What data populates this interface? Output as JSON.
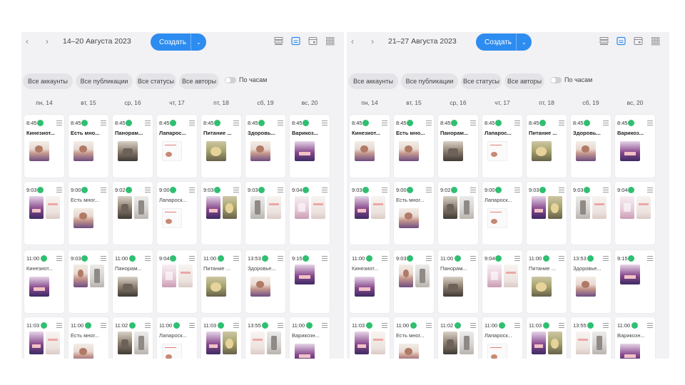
{
  "panels": [
    {
      "week_label": "14–20 Августа 2023",
      "create_label": "Создать",
      "filters": [
        "Все аккаунты",
        "Все публикации",
        "Все статусы",
        "Все авторы"
      ],
      "hourly_label": "По часам",
      "days": [
        "пн, 14",
        "вт, 15",
        "ср, 16",
        "чт, 17",
        "пт, 18",
        "сб, 19",
        "вс, 20"
      ],
      "rows": [
        [
          {
            "time": "8:45",
            "title": "Кинезиот...",
            "bold": true,
            "thumbs": [
              "portrait"
            ]
          },
          {
            "time": "8:45",
            "title": "Есть мно...",
            "bold": true,
            "thumbs": [
              "portrait"
            ]
          },
          {
            "time": "8:45",
            "title": "Панорам...",
            "bold": true,
            "thumbs": [
              "kitchen"
            ]
          },
          {
            "time": "8:45",
            "title": "Лапарос...",
            "bold": true,
            "thumbs": [
              "white"
            ]
          },
          {
            "time": "8:45",
            "title": "Питание ...",
            "bold": true,
            "thumbs": [
              "food"
            ]
          },
          {
            "time": "8:45",
            "title": "Здоровь...",
            "bold": true,
            "thumbs": [
              "portrait"
            ]
          },
          {
            "time": "8:45",
            "title": "Варикоз...",
            "bold": true,
            "thumbs": [
              "purple"
            ]
          }
        ],
        [
          {
            "time": "9:03",
            "title": "",
            "bold": false,
            "thumbs": [
              "purple",
              "light"
            ]
          },
          {
            "time": "9:00",
            "title": "Есть мног...",
            "bold": false,
            "thumbs": [
              "portrait"
            ]
          },
          {
            "time": "9:02",
            "title": "",
            "bold": false,
            "thumbs": [
              "kitchen",
              "gray"
            ]
          },
          {
            "time": "9:00",
            "title": "Лапароск...",
            "bold": false,
            "thumbs": [
              "white"
            ]
          },
          {
            "time": "9:03",
            "title": "",
            "bold": false,
            "thumbs": [
              "purple",
              "food"
            ]
          },
          {
            "time": "9:03",
            "title": "",
            "bold": false,
            "thumbs": [
              "gray",
              "light"
            ]
          },
          {
            "time": "9:04",
            "title": "",
            "bold": false,
            "thumbs": [
              "pink",
              "light"
            ]
          }
        ],
        [
          {
            "time": "11:00",
            "title": "Кинезиот...",
            "bold": false,
            "thumbs": [
              "purple"
            ]
          },
          {
            "time": "9:03",
            "title": "",
            "bold": false,
            "thumbs": [
              "portrait",
              "gray"
            ]
          },
          {
            "time": "11:00",
            "title": "Панорам...",
            "bold": false,
            "thumbs": [
              "kitchen"
            ]
          },
          {
            "time": "9:04",
            "title": "",
            "bold": false,
            "thumbs": [
              "pink",
              "light"
            ]
          },
          {
            "time": "11:00",
            "title": "Питание ...",
            "bold": false,
            "thumbs": [
              "food"
            ]
          },
          {
            "time": "13:53",
            "title": "Здоровье...",
            "bold": false,
            "thumbs": [
              "portrait"
            ]
          },
          {
            "time": "9:15",
            "title": "",
            "bold": false,
            "thumbs": [
              "purple"
            ]
          }
        ],
        [
          {
            "time": "11:03",
            "title": "",
            "bold": false,
            "thumbs": [
              "purple",
              "light"
            ]
          },
          {
            "time": "11:00",
            "title": "Есть мног...",
            "bold": false,
            "thumbs": [
              "portrait"
            ]
          },
          {
            "time": "11:02",
            "title": "",
            "bold": false,
            "thumbs": [
              "kitchen",
              "gray"
            ]
          },
          {
            "time": "11:00",
            "title": "Лапароск...",
            "bold": false,
            "thumbs": [
              "white"
            ]
          },
          {
            "time": "11:03",
            "title": "",
            "bold": false,
            "thumbs": [
              "purple",
              "food"
            ]
          },
          {
            "time": "13:55",
            "title": "",
            "bold": false,
            "thumbs": [
              "light",
              "gray"
            ]
          },
          {
            "time": "11:00",
            "title": "Варикозн...",
            "bold": false,
            "thumbs": [
              "purple"
            ]
          }
        ]
      ]
    },
    {
      "week_label": "21–27 Августа 2023",
      "create_label": "Создать",
      "filters": [
        "Все аккаунты",
        "Все публикации",
        "Все статусы",
        "Все авторы"
      ],
      "hourly_label": "По часам",
      "days": [
        "пн, 14",
        "вт, 15",
        "ср, 16",
        "чт, 17",
        "пт, 18",
        "сб, 19",
        "вс, 20"
      ],
      "rows": [
        [
          {
            "time": "8:45",
            "title": "Кинезиот...",
            "bold": true,
            "thumbs": [
              "portrait"
            ]
          },
          {
            "time": "8:45",
            "title": "Есть мно...",
            "bold": true,
            "thumbs": [
              "portrait"
            ]
          },
          {
            "time": "8:45",
            "title": "Панорам...",
            "bold": true,
            "thumbs": [
              "kitchen"
            ]
          },
          {
            "time": "8:45",
            "title": "Лапарос...",
            "bold": true,
            "thumbs": [
              "white"
            ]
          },
          {
            "time": "8:45",
            "title": "Питание ...",
            "bold": true,
            "thumbs": [
              "food"
            ]
          },
          {
            "time": "8:45",
            "title": "Здоровь...",
            "bold": true,
            "thumbs": [
              "portrait"
            ]
          },
          {
            "time": "8:45",
            "title": "Варикоз...",
            "bold": true,
            "thumbs": [
              "purple"
            ]
          }
        ],
        [
          {
            "time": "9:03",
            "title": "",
            "bold": false,
            "thumbs": [
              "purple",
              "light"
            ]
          },
          {
            "time": "9:00",
            "title": "Есть мног...",
            "bold": false,
            "thumbs": [
              "portrait"
            ]
          },
          {
            "time": "9:02",
            "title": "",
            "bold": false,
            "thumbs": [
              "kitchen",
              "gray"
            ]
          },
          {
            "time": "9:00",
            "title": "Лапароск...",
            "bold": false,
            "thumbs": [
              "white"
            ]
          },
          {
            "time": "9:03",
            "title": "",
            "bold": false,
            "thumbs": [
              "purple",
              "food"
            ]
          },
          {
            "time": "9:03",
            "title": "",
            "bold": false,
            "thumbs": [
              "gray",
              "light"
            ]
          },
          {
            "time": "9:04",
            "title": "",
            "bold": false,
            "thumbs": [
              "pink",
              "light"
            ]
          }
        ],
        [
          {
            "time": "11:00",
            "title": "Кинезиот...",
            "bold": false,
            "thumbs": [
              "purple"
            ]
          },
          {
            "time": "9:03",
            "title": "",
            "bold": false,
            "thumbs": [
              "portrait",
              "gray"
            ]
          },
          {
            "time": "11:00",
            "title": "Панорам...",
            "bold": false,
            "thumbs": [
              "kitchen"
            ]
          },
          {
            "time": "9:04",
            "title": "",
            "bold": false,
            "thumbs": [
              "pink",
              "light"
            ]
          },
          {
            "time": "11:00",
            "title": "Питание ...",
            "bold": false,
            "thumbs": [
              "food"
            ]
          },
          {
            "time": "13:53",
            "title": "Здоровье...",
            "bold": false,
            "thumbs": [
              "portrait"
            ]
          },
          {
            "time": "9:15",
            "title": "",
            "bold": false,
            "thumbs": [
              "purple"
            ]
          }
        ],
        [
          {
            "time": "11:03",
            "title": "",
            "bold": false,
            "thumbs": [
              "purple",
              "light"
            ]
          },
          {
            "time": "11:00",
            "title": "Есть мног...",
            "bold": false,
            "thumbs": [
              "portrait"
            ]
          },
          {
            "time": "11:02",
            "title": "",
            "bold": false,
            "thumbs": [
              "kitchen",
              "gray"
            ]
          },
          {
            "time": "11:00",
            "title": "Лапароск...",
            "bold": false,
            "thumbs": [
              "white"
            ]
          },
          {
            "time": "11:03",
            "title": "",
            "bold": false,
            "thumbs": [
              "purple",
              "food"
            ]
          },
          {
            "time": "13:55",
            "title": "",
            "bold": false,
            "thumbs": [
              "light",
              "gray"
            ]
          },
          {
            "time": "11:00",
            "title": "Варикозн...",
            "bold": false,
            "thumbs": [
              "purple"
            ]
          }
        ]
      ]
    }
  ],
  "colors": {
    "accent": "#2d8cf0",
    "status_dot": "#2fbf71",
    "panel_bg": "#f2f2f4",
    "chip_bg": "#e4e4e8",
    "active_view": "#2d8cf0"
  },
  "icons": {
    "nav_prev": "chevron-left-icon",
    "nav_next": "chevron-right-icon",
    "views": [
      "list-view-icon",
      "week-view-icon",
      "month-view-icon",
      "grid-view-icon"
    ],
    "card_menu": "menu-icon",
    "status": "status-dot-icon"
  }
}
